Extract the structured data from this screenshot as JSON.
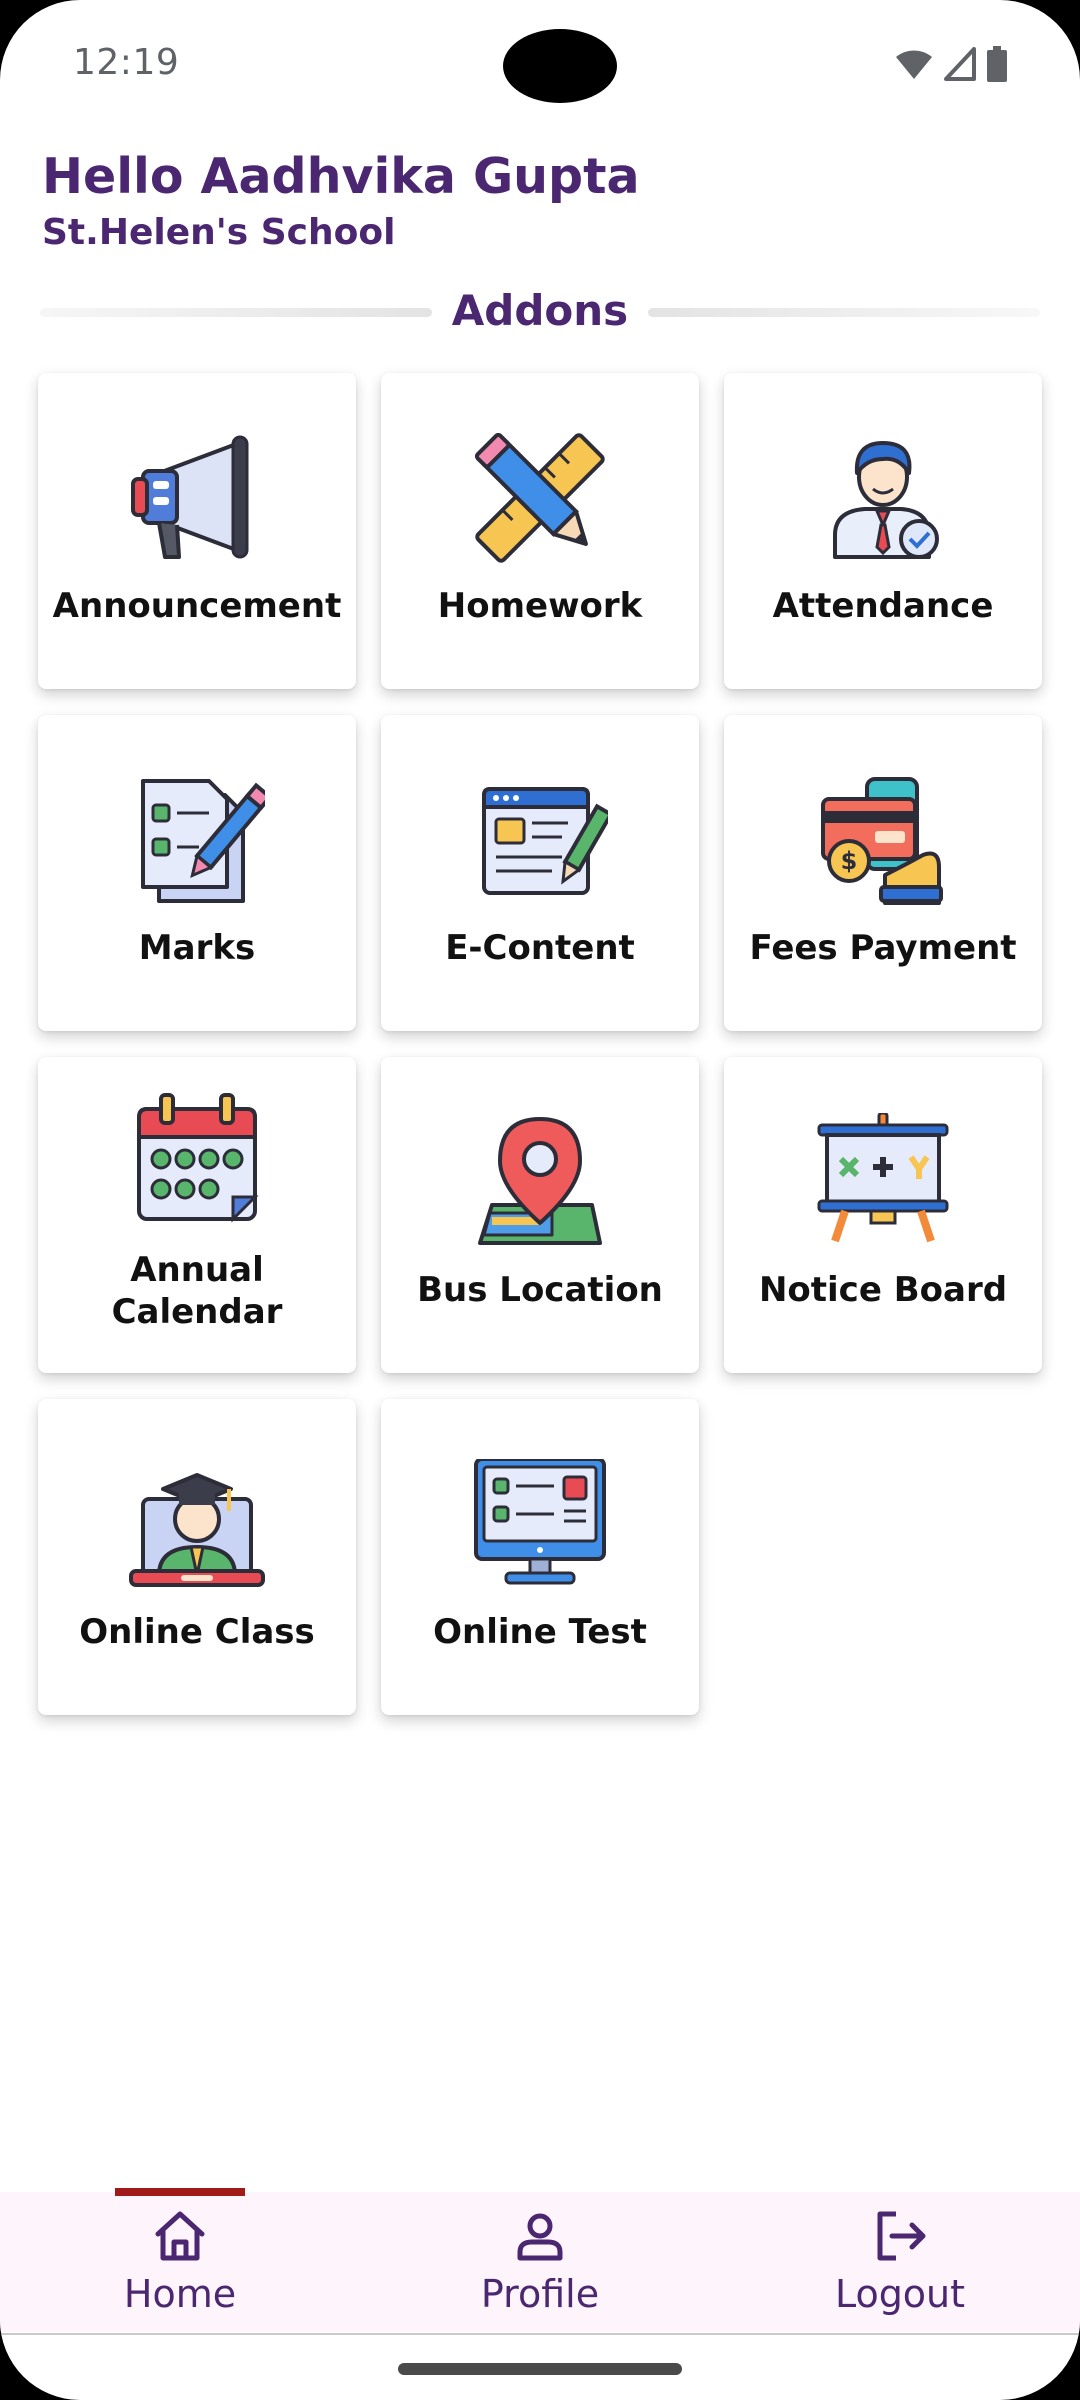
{
  "status_bar": {
    "time": "12:19"
  },
  "header": {
    "greeting": "Hello Aadhvika Gupta",
    "school": "St.Helen's School",
    "section_title": "Addons"
  },
  "tiles": [
    {
      "label": "Announcement",
      "icon": "megaphone-icon"
    },
    {
      "label": "Homework",
      "icon": "pencil-ruler-icon"
    },
    {
      "label": "Attendance",
      "icon": "student-check-icon"
    },
    {
      "label": "Marks",
      "icon": "report-card-icon"
    },
    {
      "label": "E-Content",
      "icon": "document-pen-icon"
    },
    {
      "label": "Fees Payment",
      "icon": "card-payment-icon"
    },
    {
      "label": "Annual Calendar",
      "label_line1": "Annual",
      "label_line2": "Calendar",
      "icon": "calendar-icon"
    },
    {
      "label": "Bus Location",
      "icon": "map-pin-icon"
    },
    {
      "label": "Notice Board",
      "icon": "whiteboard-icon"
    },
    {
      "label": "Online Class",
      "icon": "graduate-screen-icon"
    },
    {
      "label": "Online Test",
      "icon": "monitor-test-icon"
    }
  ],
  "bottom_nav": {
    "items": [
      {
        "label": "Home",
        "icon": "home-icon",
        "active": true
      },
      {
        "label": "Profile",
        "icon": "user-icon",
        "active": false
      },
      {
        "label": "Logout",
        "icon": "logout-icon",
        "active": false
      }
    ]
  },
  "colors": {
    "brand": "#4a2770",
    "active_indicator": "#a11a1a",
    "nav_background": "#fdf5fb"
  }
}
